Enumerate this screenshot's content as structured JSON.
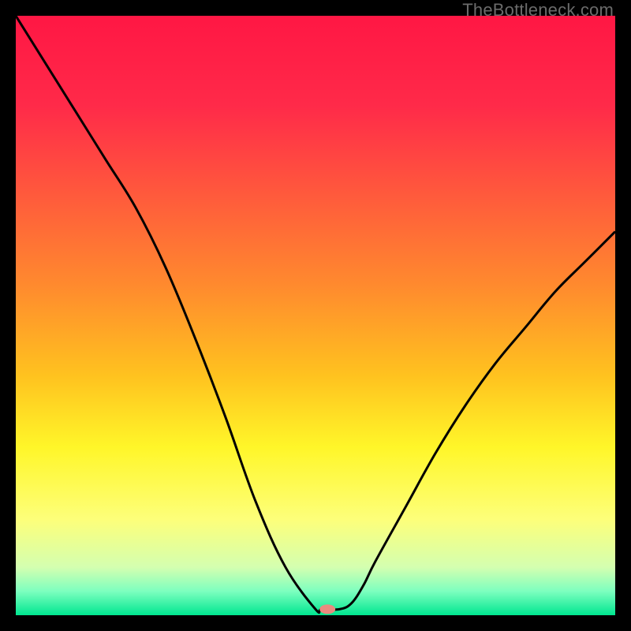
{
  "watermark": "TheBottleneck.com",
  "chart_data": {
    "type": "line",
    "title": "",
    "xlabel": "",
    "ylabel": "",
    "xlim": [
      0,
      100
    ],
    "ylim": [
      0,
      100
    ],
    "series": [
      {
        "name": "bottleneck-curve",
        "x": [
          0,
          5,
          10,
          15,
          20,
          25,
          30,
          35,
          40,
          45,
          50,
          51,
          54,
          56,
          58,
          60,
          65,
          70,
          75,
          80,
          85,
          90,
          95,
          100
        ],
        "y": [
          100,
          92,
          84,
          76,
          68,
          58,
          46,
          33,
          19,
          8,
          1,
          1,
          1,
          2,
          5,
          9,
          18,
          27,
          35,
          42,
          48,
          54,
          59,
          64
        ]
      }
    ],
    "marker": {
      "x": 52,
      "y": 1,
      "label": "optimal-point"
    },
    "gradient_stops": [
      {
        "offset": 0,
        "color": "#ff1744"
      },
      {
        "offset": 15,
        "color": "#ff2a49"
      },
      {
        "offset": 30,
        "color": "#ff5a3c"
      },
      {
        "offset": 45,
        "color": "#ff8a2e"
      },
      {
        "offset": 60,
        "color": "#ffc21f"
      },
      {
        "offset": 72,
        "color": "#fff629"
      },
      {
        "offset": 84,
        "color": "#fdff7a"
      },
      {
        "offset": 92,
        "color": "#d4ffb0"
      },
      {
        "offset": 96,
        "color": "#7dffbf"
      },
      {
        "offset": 100,
        "color": "#00e690"
      }
    ]
  }
}
